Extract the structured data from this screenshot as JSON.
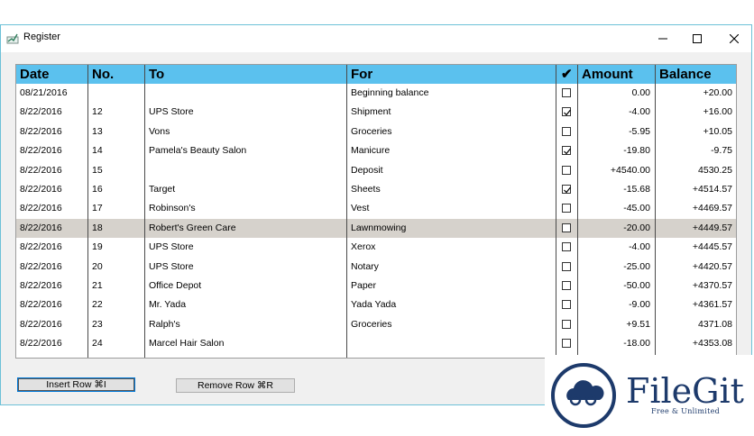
{
  "window": {
    "title": "Register"
  },
  "columns": [
    "Date",
    "No.",
    "To",
    "For",
    "✔",
    "Amount",
    "Balance"
  ],
  "rows": [
    {
      "date": "08/21/2016",
      "no": "",
      "to": "",
      "for": "Beginning balance",
      "checked": false,
      "amount": "0.00",
      "balance": "+20.00"
    },
    {
      "date": "8/22/2016",
      "no": "12",
      "to": "UPS Store",
      "for": "Shipment",
      "checked": true,
      "amount": "-4.00",
      "balance": "+16.00"
    },
    {
      "date": "8/22/2016",
      "no": "13",
      "to": "Vons",
      "for": "Groceries",
      "checked": false,
      "amount": "-5.95",
      "balance": "+10.05"
    },
    {
      "date": "8/22/2016",
      "no": "14",
      "to": "Pamela's Beauty Salon",
      "for": "Manicure",
      "checked": true,
      "amount": "-19.80",
      "balance": "-9.75"
    },
    {
      "date": "8/22/2016",
      "no": "15",
      "to": "",
      "for": "Deposit",
      "checked": false,
      "amount": "+4540.00",
      "balance": "4530.25"
    },
    {
      "date": "8/22/2016",
      "no": "16",
      "to": "Target",
      "for": "Sheets",
      "checked": true,
      "amount": "-15.68",
      "balance": "+4514.57"
    },
    {
      "date": "8/22/2016",
      "no": "17",
      "to": "Robinson's",
      "for": "Vest",
      "checked": false,
      "amount": "-45.00",
      "balance": "+4469.57"
    },
    {
      "date": "8/22/2016",
      "no": "18",
      "to": "Robert's Green Care",
      "for": "Lawnmowing",
      "checked": false,
      "amount": "-20.00",
      "balance": "+4449.57",
      "selected": true
    },
    {
      "date": "8/22/2016",
      "no": "19",
      "to": "UPS Store",
      "for": "Xerox",
      "checked": false,
      "amount": "-4.00",
      "balance": "+4445.57"
    },
    {
      "date": "8/22/2016",
      "no": "20",
      "to": "UPS Store",
      "for": "Notary",
      "checked": false,
      "amount": "-25.00",
      "balance": "+4420.57"
    },
    {
      "date": "8/22/2016",
      "no": "21",
      "to": "Office Depot",
      "for": "Paper",
      "checked": false,
      "amount": "-50.00",
      "balance": "+4370.57"
    },
    {
      "date": "8/22/2016",
      "no": "22",
      "to": "Mr. Yada",
      "for": "Yada Yada",
      "checked": false,
      "amount": "-9.00",
      "balance": "+4361.57"
    },
    {
      "date": "8/22/2016",
      "no": "23",
      "to": "Ralph's",
      "for": "Groceries",
      "checked": false,
      "amount": "+9.51",
      "balance": "4371.08"
    },
    {
      "date": "8/22/2016",
      "no": "24",
      "to": "Marcel Hair Salon",
      "for": "",
      "checked": false,
      "amount": "-18.00",
      "balance": "+4353.08"
    }
  ],
  "buttons": {
    "insert": "Insert Row ⌘I",
    "remove": "Remove Row ⌘R"
  },
  "watermark": {
    "brand": "FileGit",
    "tagline": "Free & Unlimited"
  },
  "colors": {
    "header": "#5bc1ee",
    "selected_row": "#d6d2cc",
    "brand": "#1d3a6b"
  },
  "icons": {
    "app": "register-icon",
    "minimize": "minimize-icon",
    "maximize": "maximize-icon",
    "close": "close-icon",
    "logo": "cloud-logo-icon"
  }
}
